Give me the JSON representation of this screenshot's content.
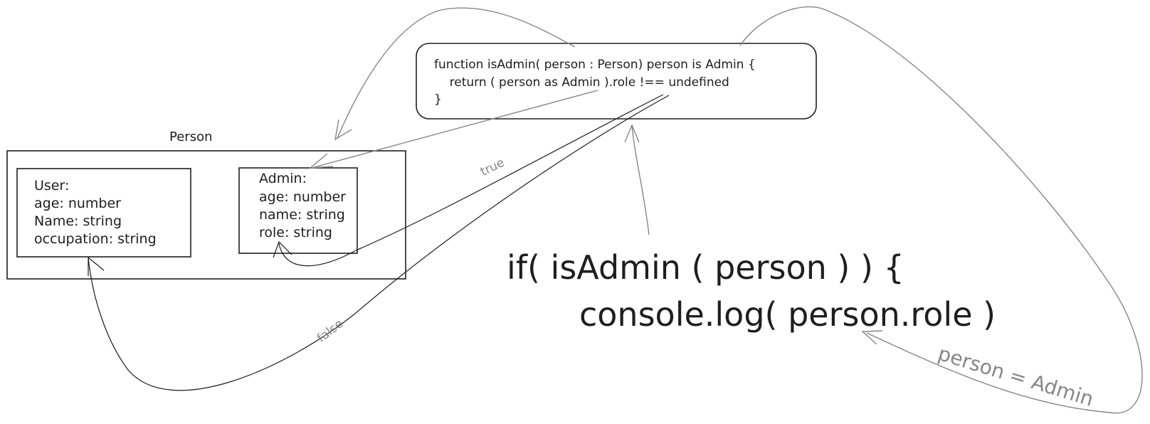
{
  "diagram": {
    "person_group": {
      "title": "Person"
    },
    "user_box": {
      "lines": [
        "User:",
        "age: number",
        "Name: string",
        "occupation: string"
      ]
    },
    "admin_box": {
      "lines": [
        "Admin:",
        "age: number",
        "name: string",
        "role: string"
      ]
    },
    "function_box": {
      "lines": [
        "function isAdmin( person : Person) person is Admin {",
        "    return ( person as Admin ).role !== undefined",
        "}"
      ]
    },
    "code": {
      "line1": "if( isAdmin ( person ) ) {",
      "line2": "console.log( person.role )"
    },
    "labels": {
      "true_label": "true",
      "false_label": "false",
      "narrowing_label": "person = Admin"
    },
    "colors": {
      "stroke": "#1e1e1e",
      "arrow": "#868686",
      "label": "#868686",
      "background": "#ffffff"
    }
  }
}
